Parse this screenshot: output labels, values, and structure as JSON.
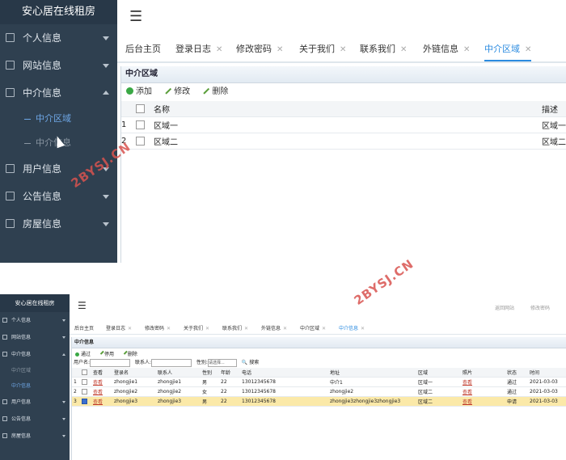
{
  "shot1": {
    "sidebar": {
      "brand": "安心居在线租房",
      "items": [
        {
          "label": "个人信息",
          "icon": "grid-icon",
          "arrow": "down"
        },
        {
          "label": "网站信息",
          "icon": "list-icon",
          "arrow": "down"
        },
        {
          "label": "中介信息",
          "icon": "list-icon",
          "arrow": "up"
        },
        {
          "label": "用户信息",
          "icon": "list-icon",
          "arrow": "down"
        },
        {
          "label": "公告信息",
          "icon": "list-icon",
          "arrow": "down"
        },
        {
          "label": "房屋信息",
          "icon": "list-icon",
          "arrow": "down"
        }
      ],
      "subitems": [
        {
          "label": "中介区域",
          "active": true
        },
        {
          "label": "中介信息",
          "active": false
        }
      ]
    },
    "header": {
      "menu_icon": "hamburger-icon"
    },
    "tabs": [
      "后台主页",
      "登录日志",
      "修改密码",
      "关于我们",
      "联系我们",
      "外链信息",
      "中介区域"
    ],
    "active_tab": "中介区域",
    "panel": {
      "title": "中介区域",
      "toolbar": {
        "add": "添加",
        "edit": "修改",
        "delete": "删除"
      },
      "columns": [
        "名称",
        "描述"
      ],
      "rows": [
        {
          "no": "1",
          "name": "区域一",
          "desc": "区域一"
        },
        {
          "no": "2",
          "name": "区域二",
          "desc": "区域二"
        }
      ]
    }
  },
  "shot2": {
    "sidebar": {
      "brand": "安心居在线租房",
      "items": [
        "个人信息",
        "网站信息",
        "中介信息",
        "用户信息",
        "公告信息",
        "房屋信息"
      ],
      "subitems": [
        {
          "label": "中介区域",
          "active": false
        },
        {
          "label": "中介信息",
          "active": true
        }
      ]
    },
    "header": {
      "links": [
        "返回网站",
        "修改密码"
      ]
    },
    "tabs": [
      "后台主页",
      "登录日志",
      "修改密码",
      "关于我们",
      "联系我们",
      "外链信息",
      "中介区域",
      "中介信息"
    ],
    "active_tab": "中介信息",
    "panel": {
      "title": "中介信息",
      "toolbar": {
        "pass": "通过",
        "disable": "停用",
        "delete": "删除"
      },
      "search": {
        "username_label": "用户名:",
        "contact_label": "联系人:",
        "gender_label": "性别:",
        "gender_placeholder": "请选择...",
        "search_button": "搜索"
      },
      "columns": [
        "查看",
        "登录名",
        "联系人",
        "性别",
        "年龄",
        "电话",
        "地址",
        "区域",
        "照片",
        "状态",
        "时间"
      ],
      "rows": [
        {
          "no": "1",
          "view": "查看",
          "login": "zhongjie1",
          "contact": "zhongjie1",
          "gender": "男",
          "age": "22",
          "phone": "13012345678",
          "address": "中介1",
          "area": "区域一",
          "photo": "查看",
          "status": "通过",
          "time": "2021-03-03",
          "checked": false
        },
        {
          "no": "2",
          "view": "查看",
          "login": "zhongjie2",
          "contact": "zhongjie2",
          "gender": "女",
          "age": "22",
          "phone": "13012345678",
          "address": "zhongjie2",
          "area": "区域二",
          "photo": "查看",
          "status": "通过",
          "time": "2021-03-03",
          "checked": false
        },
        {
          "no": "3",
          "view": "查看",
          "login": "zhongjie3",
          "contact": "zhongjie3",
          "gender": "男",
          "age": "22",
          "phone": "13012345678",
          "address": "zhongjie3zhongjie3zhongjie3",
          "area": "区域二",
          "photo": "查看",
          "status": "申请",
          "time": "2021-03-03",
          "checked": true
        }
      ]
    }
  },
  "watermark": "2BYSJ.CN",
  "colors": {
    "sidebar": "#2f4050",
    "accent": "#2b8be0",
    "selected_row": "#fbe9a8"
  }
}
